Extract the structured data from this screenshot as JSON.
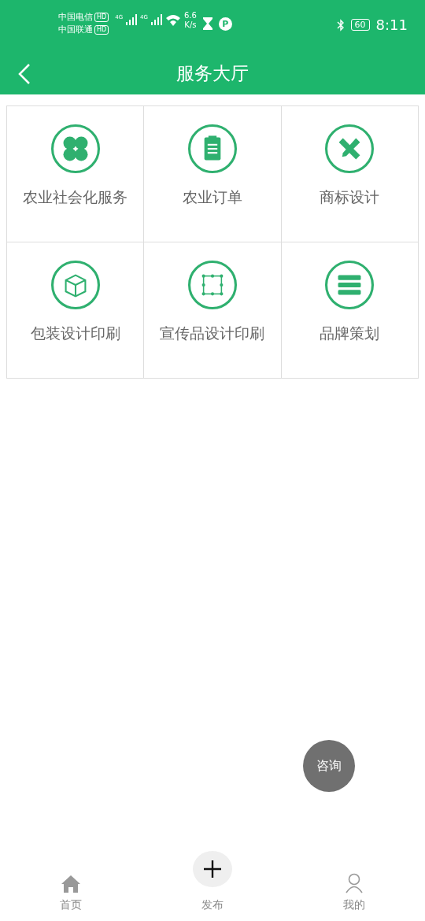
{
  "status_bar": {
    "carriers": [
      {
        "name": "中国电信",
        "badge": "HD"
      },
      {
        "name": "中国联通",
        "badge": "HD"
      }
    ],
    "network_labels": [
      "4G",
      "4G"
    ],
    "speed_value": "6.6",
    "speed_unit": "K/s",
    "parking": "P",
    "battery": "60",
    "time": "8:11"
  },
  "header": {
    "title": "服务大厅"
  },
  "services": [
    {
      "label": "农业社会化服务",
      "kind": "clover"
    },
    {
      "label": "农业订单",
      "kind": "clipboard"
    },
    {
      "label": "商标设计",
      "kind": "ruler"
    },
    {
      "label": "包装设计印刷",
      "kind": "box"
    },
    {
      "label": "宣传品设计印刷",
      "kind": "frame"
    },
    {
      "label": "品牌策划",
      "kind": "stack"
    }
  ],
  "float_button": {
    "label": "咨询"
  },
  "bottom_nav": [
    {
      "label": "首页",
      "kind": "home",
      "selected": false
    },
    {
      "label": "发布",
      "kind": "add",
      "selected": false
    },
    {
      "label": "我的",
      "kind": "user",
      "selected": false
    }
  ]
}
